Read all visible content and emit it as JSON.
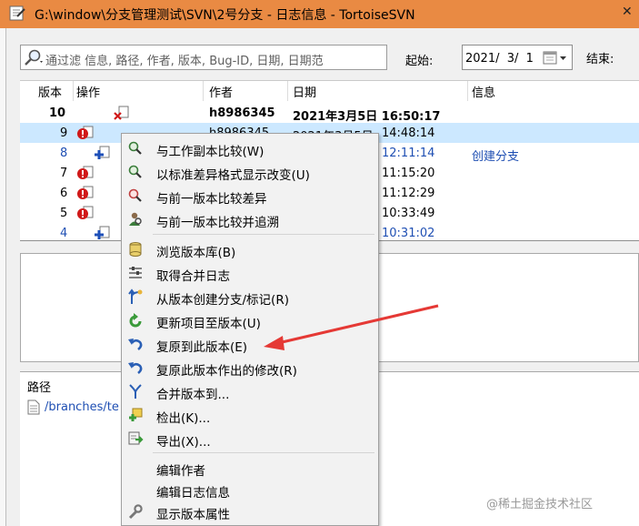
{
  "titlebar": {
    "title": "G:\\window\\分支管理测试\\SVN\\2号分支 - 日志信息 - TortoiseSVN",
    "close_label": "✕"
  },
  "filter": {
    "placeholder": "通过滤 信息, 路径, 作者, 版本, Bug-ID, 日期, 日期范"
  },
  "date_range": {
    "from_label": "起始:",
    "from_value": "2021/  3/  1",
    "to_label": "结束:"
  },
  "log": {
    "headers": {
      "revision": "版本",
      "action": "操作",
      "author": "作者",
      "date": "日期",
      "message": "信息"
    },
    "rows": [
      {
        "revision": "10",
        "author": "h8986345",
        "date": "2021年3月5日 16:50:17",
        "message": ""
      },
      {
        "revision": "9",
        "author": "h8986345",
        "date": "2021年3月5日",
        "message": ""
      },
      {
        "revision": "8",
        "author": "",
        "date": "12:11:14",
        "message": "创建分支"
      },
      {
        "revision": "7",
        "author": "",
        "date": "11:15:20",
        "message": ""
      },
      {
        "revision": "6",
        "author": "",
        "date": "11:12:29",
        "message": ""
      },
      {
        "revision": "5",
        "author": "",
        "date": "10:33:49",
        "message": ""
      },
      {
        "revision": "4",
        "author": "",
        "date": "10:31:02",
        "message": ""
      }
    ],
    "selected_time": "14:48:14"
  },
  "paths": {
    "header": "路径",
    "items": [
      "/branches/te"
    ]
  },
  "context_menu": {
    "items": [
      {
        "label": "与工作副本比较(W)",
        "icon": "magnifier-icon"
      },
      {
        "label": "以标准差异格式显示改变(U)",
        "icon": "magnifier-icon"
      },
      {
        "label": "与前一版本比较差异",
        "icon": "magnifier-icon"
      },
      {
        "label": "与前一版本比较并追溯",
        "icon": "blame-icon"
      },
      {
        "label": "浏览版本库(B)",
        "icon": "repo-browser-icon"
      },
      {
        "label": "取得合并日志",
        "icon": "merge-log-icon"
      },
      {
        "label": "从版本创建分支/标记(R)",
        "icon": "branch-icon"
      },
      {
        "label": "更新项目至版本(U)",
        "icon": "update-icon"
      },
      {
        "label": "复原到此版本(E)",
        "icon": "revert-icon"
      },
      {
        "label": "复原此版本作出的修改(R)",
        "icon": "revert-icon"
      },
      {
        "label": "合并版本到...",
        "icon": "merge-icon"
      },
      {
        "label": "检出(K)...",
        "icon": "checkout-icon"
      },
      {
        "label": "导出(X)...",
        "icon": "export-icon"
      },
      {
        "label": "编辑作者",
        "icon": ""
      },
      {
        "label": "编辑日志信息",
        "icon": ""
      },
      {
        "label": "显示版本属性",
        "icon": "wrench-icon"
      }
    ]
  },
  "colors": {
    "titlebar": "#e98a43",
    "selection": "#cce8ff",
    "arrow": "#e53935",
    "link_blue": "#1f4fb3"
  },
  "watermark": "@稀土掘金技术社区"
}
